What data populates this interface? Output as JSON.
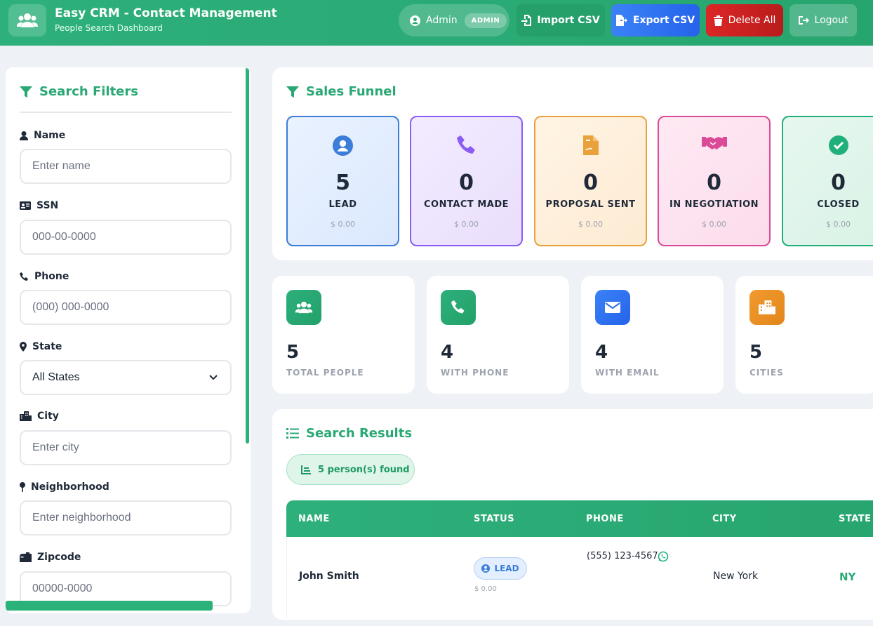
{
  "header": {
    "title": "Easy CRM - Contact Management",
    "subtitle": "People Search Dashboard",
    "user_name": "Admin",
    "user_role": "ADMIN",
    "import_label": "Import CSV",
    "export_label": "Export CSV",
    "delete_label": "Delete All",
    "logout_label": "Logout"
  },
  "filters": {
    "title": "Search Filters",
    "name_label": "Name",
    "name_placeholder": "Enter name",
    "ssn_label": "SSN",
    "ssn_placeholder": "000-00-0000",
    "phone_label": "Phone",
    "phone_placeholder": "(000) 000-0000",
    "state_label": "State",
    "state_value": "All States",
    "city_label": "City",
    "city_placeholder": "Enter city",
    "neighborhood_label": "Neighborhood",
    "neighborhood_placeholder": "Enter neighborhood",
    "zipcode_label": "Zipcode",
    "zipcode_placeholder": "00000-0000"
  },
  "funnel": {
    "title": "Sales Funnel",
    "stages": [
      {
        "count": "5",
        "name": "LEAD",
        "amount": "$ 0.00"
      },
      {
        "count": "0",
        "name": "CONTACT MADE",
        "amount": "$ 0.00"
      },
      {
        "count": "0",
        "name": "PROPOSAL SENT",
        "amount": "$ 0.00"
      },
      {
        "count": "0",
        "name": "IN NEGOTIATION",
        "amount": "$ 0.00"
      },
      {
        "count": "0",
        "name": "CLOSED",
        "amount": "$ 0.00"
      }
    ]
  },
  "stats": [
    {
      "value": "5",
      "label": "TOTAL PEOPLE"
    },
    {
      "value": "4",
      "label": "WITH PHONE"
    },
    {
      "value": "4",
      "label": "WITH EMAIL"
    },
    {
      "value": "5",
      "label": "CITIES"
    }
  ],
  "results": {
    "title": "Search Results",
    "found_text": "5 person(s) found",
    "columns": [
      "NAME",
      "STATUS",
      "PHONE",
      "CITY",
      "STATE"
    ],
    "rows": [
      {
        "name": "John Smith",
        "status": "LEAD",
        "amount": "$ 0.00",
        "phone": "(555) 123-4567",
        "city": "New York",
        "state": "NY"
      }
    ]
  },
  "colors": {
    "brand": "#2aa874",
    "lead": "#3b7dd8",
    "contact": "#8b5cf6",
    "proposal": "#e9a23b",
    "negotiation": "#db4a96",
    "closed": "#22b07a"
  }
}
